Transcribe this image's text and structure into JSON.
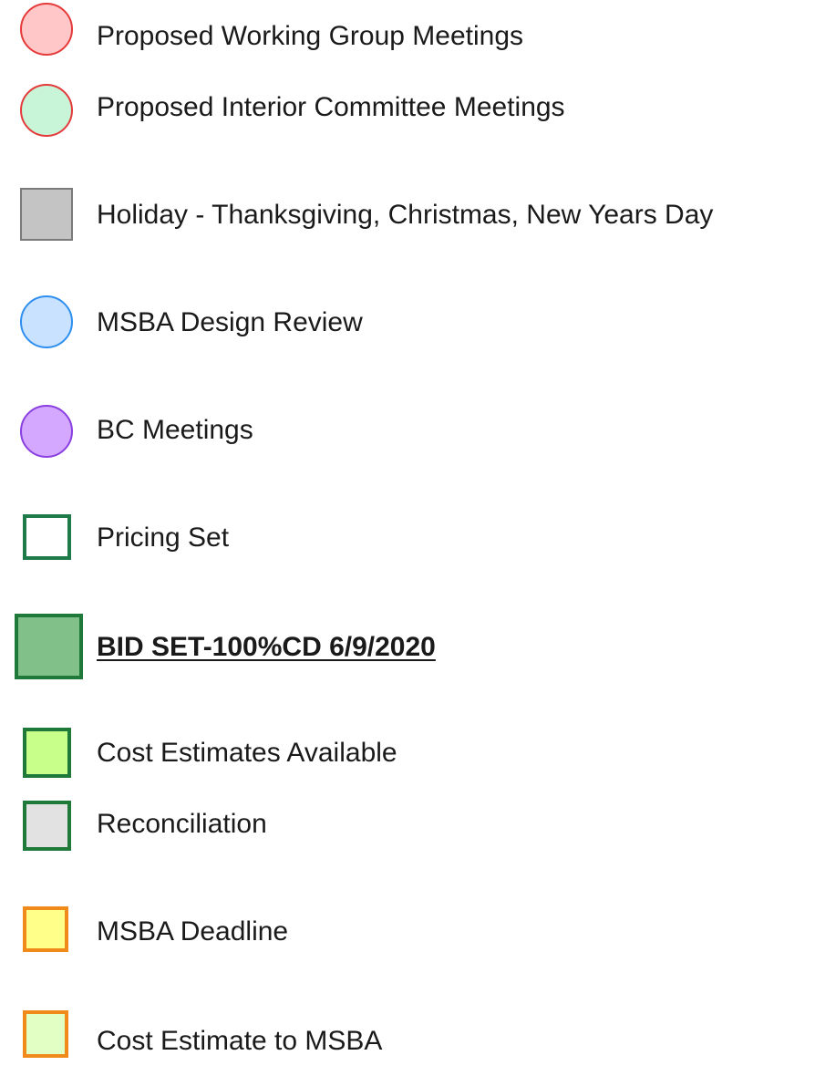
{
  "legend": {
    "items": [
      {
        "label": "Proposed Working Group Meetings",
        "shape": "circle",
        "fill": "#ffc7c7",
        "border": "#e53a3a",
        "bold": false
      },
      {
        "label": "Proposed Interior Committee Meetings",
        "shape": "circle",
        "fill": "#c8f5d8",
        "border": "#e53a3a",
        "bold": false
      },
      {
        "label": "Holiday - Thanksgiving, Christmas, New Years Day",
        "shape": "square",
        "fill": "#c4c4c4",
        "border": "#7a7a7a",
        "bold": false
      },
      {
        "label": "MSBA Design Review",
        "shape": "circle",
        "fill": "#c8e2ff",
        "border": "#2e8ff0",
        "bold": false
      },
      {
        "label": "BC Meetings",
        "shape": "circle",
        "fill": "#d4a8ff",
        "border": "#8a3fe0",
        "bold": false
      },
      {
        "label": "Pricing Set",
        "shape": "square",
        "fill": "#ffffff",
        "border": "#1f7a4a",
        "bold": false
      },
      {
        "label": "BID SET-100%CD 6/9/2020",
        "shape": "square",
        "fill": "#82c08a",
        "border": "#1f7a3a",
        "bold": true
      },
      {
        "label": "Cost Estimates Available",
        "shape": "square",
        "fill": "#c8ff8a",
        "border": "#1f7a3a",
        "bold": false
      },
      {
        "label": "Reconciliation",
        "shape": "square",
        "fill": "#e2e2e2",
        "border": "#1f7a3a",
        "bold": false
      },
      {
        "label": "MSBA Deadline",
        "shape": "square",
        "fill": "#ffff8a",
        "border": "#f08a1a",
        "bold": false
      },
      {
        "label": "Cost Estimate to MSBA",
        "shape": "square",
        "fill": "#e2ffc4",
        "border": "#f08a1a",
        "bold": false
      }
    ]
  }
}
